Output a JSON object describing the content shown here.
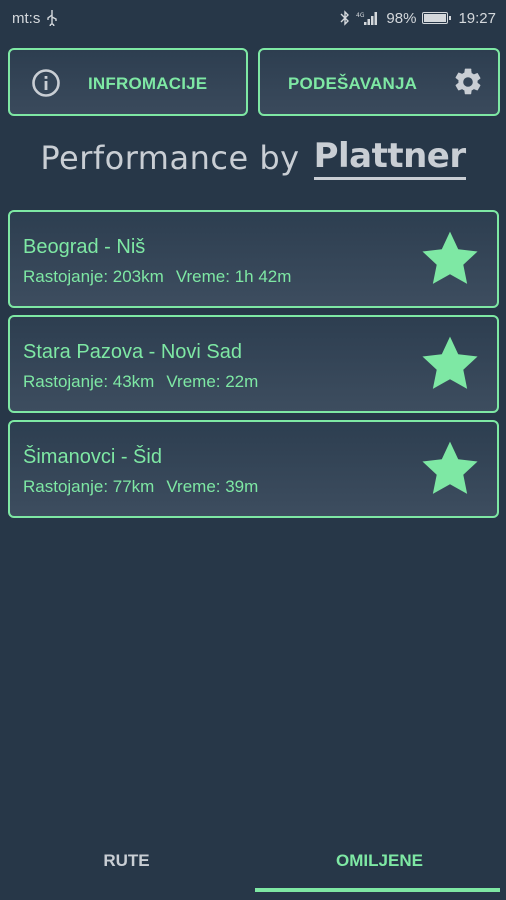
{
  "status_bar": {
    "carrier": "mt:s",
    "battery": "98%",
    "time": "19:27",
    "icons": [
      "usb-icon",
      "bluetooth-icon",
      "signal-icon",
      "battery-icon"
    ]
  },
  "header": {
    "info_label": "INFROMACIJE",
    "settings_label": "PODEŠAVANJA",
    "info_icon": "info-icon",
    "settings_icon": "gear-icon"
  },
  "brand": {
    "text": "Performance by",
    "logo": "Plattner"
  },
  "routes": [
    {
      "name": "Beograd - Niš",
      "distance": "Rastojanje: 203km",
      "time": "Vreme: 1h 42m"
    },
    {
      "name": "Stara Pazova - Novi Sad",
      "distance": "Rastojanje: 43km",
      "time": "Vreme: 22m"
    },
    {
      "name": "Šimanovci - Šid",
      "distance": "Rastojanje: 77km",
      "time": "Vreme: 39m"
    }
  ],
  "tabs": {
    "routes_label": "RUTE",
    "favorites_label": "OMILJENE",
    "active": "OMILJENE"
  },
  "colors": {
    "background": "#273748",
    "accent": "#7ee8a4",
    "muted_text": "#c9ced4"
  }
}
